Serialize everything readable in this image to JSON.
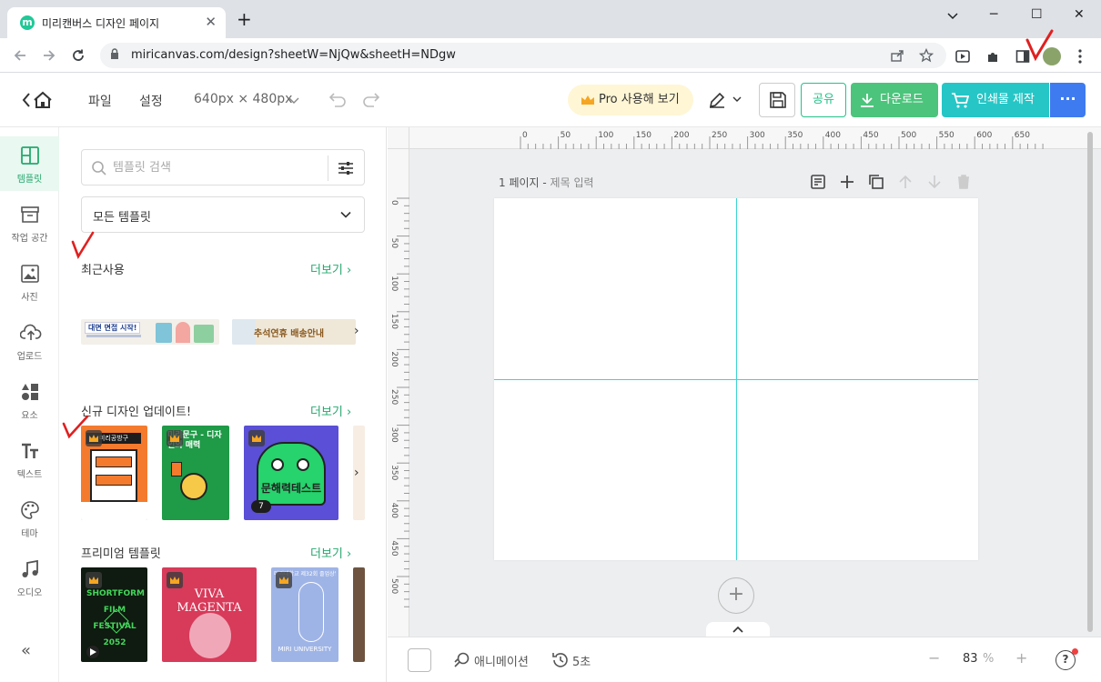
{
  "browser": {
    "tab_title": "미리캔버스 디자인 페이지",
    "favicon_letter": "m",
    "new_tab": "+",
    "window_minimize": "─",
    "window_maximize": "☐",
    "window_close": "✕",
    "tab_close": "✕",
    "url": "miricanvas.com/design?sheetW=NjQw&sheetH=NDgw"
  },
  "header": {
    "file_menu": "파일",
    "settings_menu": "설정",
    "canvas_size": "640px × 480px",
    "pro_button": "Pro 사용해 보기",
    "share_button": "공유",
    "download_button": "다운로드",
    "print_button": "인쇄물 제작",
    "more_button": "···"
  },
  "left_nav": {
    "items": [
      {
        "label": "템플릿",
        "icon": "template-icon",
        "active": true
      },
      {
        "label": "작업 공간",
        "icon": "archive-icon"
      },
      {
        "label": "사진",
        "icon": "photo-icon"
      },
      {
        "label": "업로드",
        "icon": "upload-icon"
      },
      {
        "label": "요소",
        "icon": "shapes-icon"
      },
      {
        "label": "텍스트",
        "icon": "text-icon"
      },
      {
        "label": "테마",
        "icon": "palette-icon"
      },
      {
        "label": "오디오",
        "icon": "music-icon"
      }
    ],
    "collapse": "«"
  },
  "panel": {
    "search_placeholder": "템플릿 검색",
    "category_select": "모든 템플릿",
    "sections": [
      {
        "title": "최근사용",
        "more": "더보기"
      },
      {
        "title": "신규 디자인 업데이트!",
        "more": "더보기"
      },
      {
        "title": "프리미엄 템플릿",
        "more": "더보기"
      }
    ],
    "recent_thumbs": [
      "대면 면접 시작!",
      "추석연휴 배송안내"
    ],
    "new_thumbs": [
      "미리공방구",
      "미리문구 - 디자인의 매력",
      "문해력테스트"
    ],
    "new_thumb_badge": "7",
    "premium_thumbs": [
      "SHORTFORM FILM FESTIVAL 2052",
      "VIVA MAGENTA",
      "MIRI UNIVERSITY"
    ],
    "premium_small_text": [
      "2000. 11. 23 - 26",
      "미리대학교 제32회 졸업상영회"
    ]
  },
  "canvas": {
    "page_number": "1 페이지 -",
    "page_title_placeholder": "제목 입력",
    "ruler_top": [
      "0",
      "50",
      "100",
      "150",
      "200",
      "250",
      "300",
      "350",
      "400",
      "450",
      "500",
      "550",
      "600",
      "650"
    ],
    "ruler_left": [
      "0",
      "50",
      "100",
      "150",
      "200",
      "250",
      "300",
      "350",
      "400",
      "450",
      "500"
    ],
    "add_page": "+"
  },
  "bottom": {
    "animation": "애니메이션",
    "duration": "5초",
    "zoom_value": "83",
    "zoom_unit": "%",
    "zoom_minus": "−",
    "zoom_plus": "+",
    "help": "?"
  },
  "colors": {
    "brand_green": "#24a86e",
    "download_green": "#4cc47c",
    "print_teal": "#26c6c6",
    "more_blue": "#3e7bf0",
    "guide_cyan": "#3cd3d3",
    "annotation_red": "#e02020"
  }
}
